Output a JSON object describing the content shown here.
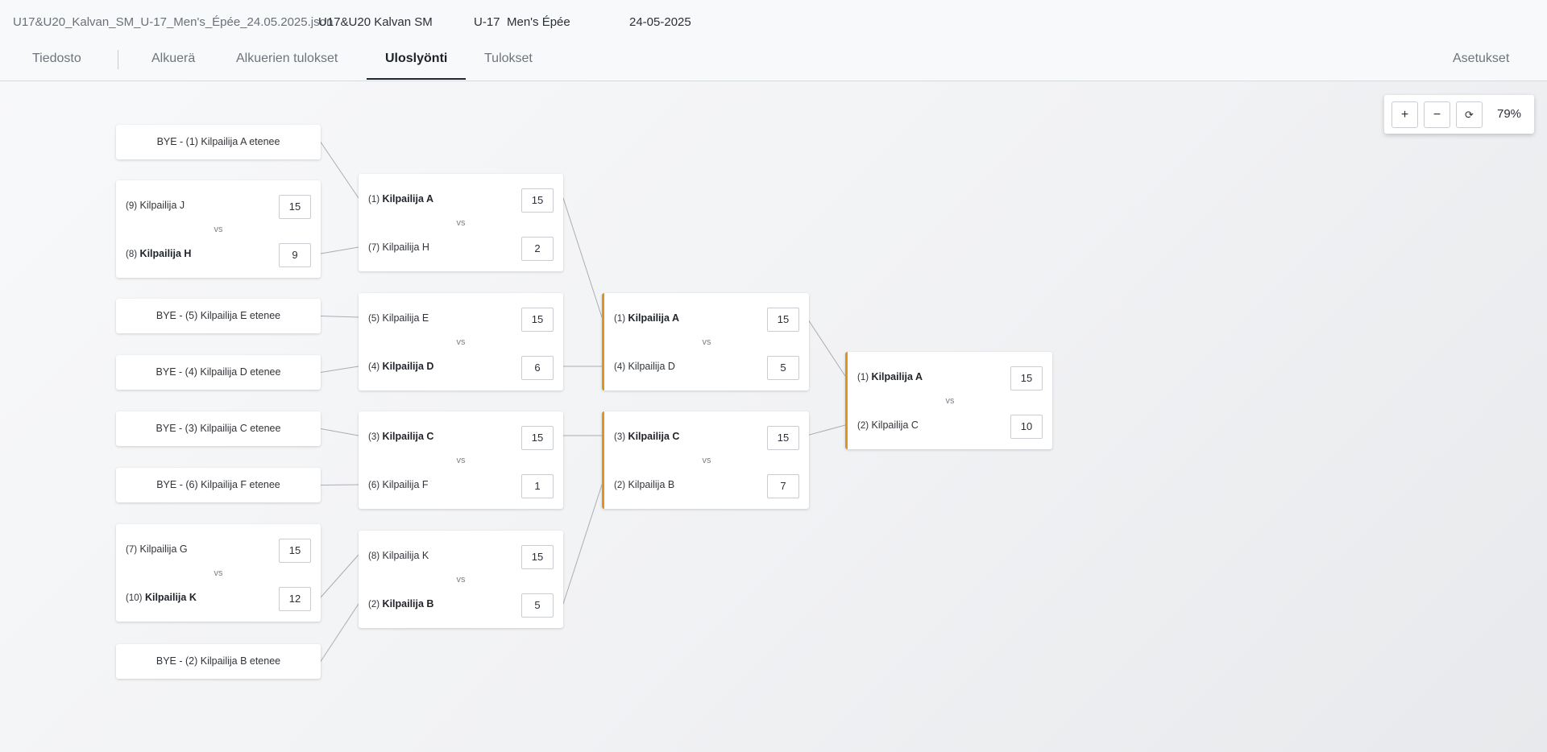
{
  "header": {
    "filename": "U17&U20_Kalvan_SM_U-17_Men's_Épée_24.05.2025.json",
    "event": "U17&U20 Kalvan SM",
    "category": "U-17",
    "weapon": "Men's Épée",
    "date": "24-05-2025"
  },
  "tabs": [
    "Tiedosto",
    "Alkuerä",
    "Alkuerien tulokset",
    "Uloslyönti",
    "Tulokset"
  ],
  "active_tab": "Uloslyönti",
  "settings_label": "Asetukset",
  "zoom": {
    "plus": "+",
    "minus": "−",
    "reset_icon": "refresh-icon",
    "reset": "⟳",
    "level": "79%"
  },
  "vs_label": "vs",
  "accent_color": "#e0941c",
  "bracket": {
    "round1": [
      {
        "bye": "BYE - (1) Kilpailija A etenee"
      },
      {
        "top": {
          "seed": "(9)",
          "name": "Kilpailija J",
          "score": "15",
          "win": false
        },
        "bottom": {
          "seed": "(8)",
          "name": "Kilpailija H",
          "score": "9",
          "win": true
        }
      },
      {
        "bye": "BYE - (5) Kilpailija E etenee"
      },
      {
        "bye": "BYE - (4) Kilpailija D etenee"
      },
      {
        "bye": "BYE - (3) Kilpailija C etenee"
      },
      {
        "bye": "BYE - (6) Kilpailija F etenee"
      },
      {
        "top": {
          "seed": "(7)",
          "name": "Kilpailija G",
          "score": "15",
          "win": false
        },
        "bottom": {
          "seed": "(10)",
          "name": "Kilpailija K",
          "score": "12",
          "win": true
        }
      },
      {
        "bye": "BYE - (2) Kilpailija B etenee"
      }
    ],
    "round2": [
      {
        "top": {
          "seed": "(1)",
          "name": "Kilpailija A",
          "score": "15",
          "win": true
        },
        "bottom": {
          "seed": "(7)",
          "name": "Kilpailija H",
          "score": "2",
          "win": false
        }
      },
      {
        "top": {
          "seed": "(5)",
          "name": "Kilpailija E",
          "score": "15",
          "win": false
        },
        "bottom": {
          "seed": "(4)",
          "name": "Kilpailija D",
          "score": "6",
          "win": true
        }
      },
      {
        "top": {
          "seed": "(3)",
          "name": "Kilpailija C",
          "score": "15",
          "win": true
        },
        "bottom": {
          "seed": "(6)",
          "name": "Kilpailija F",
          "score": "1",
          "win": false
        }
      },
      {
        "top": {
          "seed": "(8)",
          "name": "Kilpailija K",
          "score": "15",
          "win": false
        },
        "bottom": {
          "seed": "(2)",
          "name": "Kilpailija B",
          "score": "5",
          "win": true
        }
      }
    ],
    "round3": [
      {
        "top": {
          "seed": "(1)",
          "name": "Kilpailija A",
          "score": "15",
          "win": true
        },
        "bottom": {
          "seed": "(4)",
          "name": "Kilpailija D",
          "score": "5",
          "win": false
        }
      },
      {
        "top": {
          "seed": "(3)",
          "name": "Kilpailija C",
          "score": "15",
          "win": true
        },
        "bottom": {
          "seed": "(2)",
          "name": "Kilpailija B",
          "score": "7",
          "win": false
        }
      }
    ],
    "final": [
      {
        "top": {
          "seed": "(1)",
          "name": "Kilpailija A",
          "score": "15",
          "win": true
        },
        "bottom": {
          "seed": "(2)",
          "name": "Kilpailija C",
          "score": "10",
          "win": false
        }
      }
    ]
  }
}
